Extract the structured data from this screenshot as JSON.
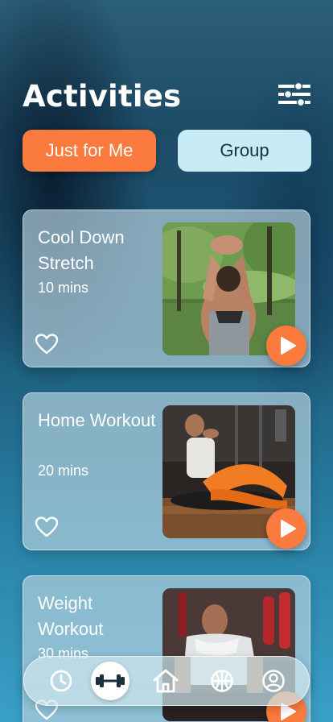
{
  "header": {
    "title": "Activities",
    "filter_icon": "sliders-icon"
  },
  "tabs": [
    {
      "label": "Just for Me",
      "active": true
    },
    {
      "label": "Group",
      "active": false
    }
  ],
  "activities": [
    {
      "title": "Cool Down Stretch",
      "duration": "10 mins",
      "image": "woman stretching arms overhead in park"
    },
    {
      "title": "Home Workout",
      "duration": "20 mins",
      "image": "woman doing sit-ups on mat in orange leggings"
    },
    {
      "title": "Weight Workout",
      "duration": "30 mins",
      "image": "man with towel at gym with punching bags"
    }
  ],
  "nav": {
    "items": [
      {
        "icon": "clock-icon",
        "active": false
      },
      {
        "icon": "dumbbell-icon",
        "active": true
      },
      {
        "icon": "home-icon",
        "active": false
      },
      {
        "icon": "ball-icon",
        "active": false
      },
      {
        "icon": "profile-icon",
        "active": false
      }
    ]
  },
  "colors": {
    "accent": "#fb7a3d",
    "tab_inactive": "#c8ecf6",
    "background_dark": "#1d4c67",
    "background_light": "#3aa0c7"
  }
}
